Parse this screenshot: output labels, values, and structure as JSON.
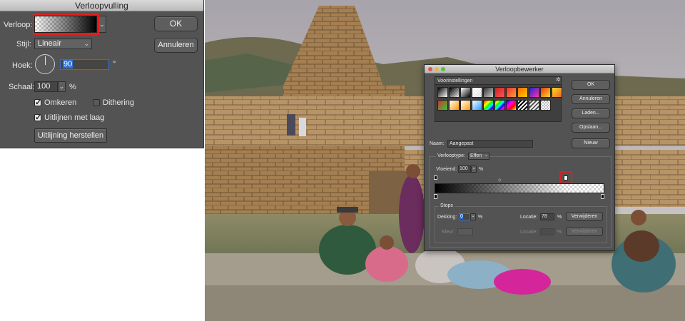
{
  "fill_dialog": {
    "title": "Verloopvulling",
    "gradient_label": "Verloop:",
    "style_label": "Stijl:",
    "style_value": "Lineair",
    "angle_label": "Hoek:",
    "angle_value": "90",
    "angle_unit": "°",
    "scale_label": "Schaal:",
    "scale_value": "100",
    "scale_unit": "%",
    "reverse_label": "Omkeren",
    "reverse_checked": true,
    "dither_label": "Dithering",
    "dither_checked": false,
    "align_label": "Uitlijnen met laag",
    "align_checked": true,
    "reset_align_label": "Uitlijning herstellen",
    "ok_label": "OK",
    "cancel_label": "Annuleren"
  },
  "editor_dialog": {
    "title": "Verloopbewerker",
    "presets_label": "Voorinstellingen",
    "ok_label": "OK",
    "cancel_label": "Annuleren",
    "load_label": "Laden...",
    "save_label": "Opslaan...",
    "name_label": "Naam:",
    "name_value": "Aangepast",
    "new_label": "Nieuw",
    "type_label": "Verlooptype:",
    "type_value": "Effen",
    "smoothness_label": "Vloeiend:",
    "smoothness_value": "100",
    "smoothness_unit": "%",
    "stops_title": "Stops",
    "opacity_label": "Dekking:",
    "opacity_value": "0",
    "opacity_unit": "%",
    "location_label": "Locatie:",
    "location_value": "78",
    "location_unit": "%",
    "delete_label": "Verwijderen",
    "color_label": "Kleur:",
    "color_location_label": "Locatie:",
    "color_location_unit": "%",
    "color_delete_label": "Verwijderen"
  },
  "colors": {
    "dialog_bg": "#535353",
    "highlight_red": "#e02020",
    "selected_field": "#2d6fd6"
  }
}
